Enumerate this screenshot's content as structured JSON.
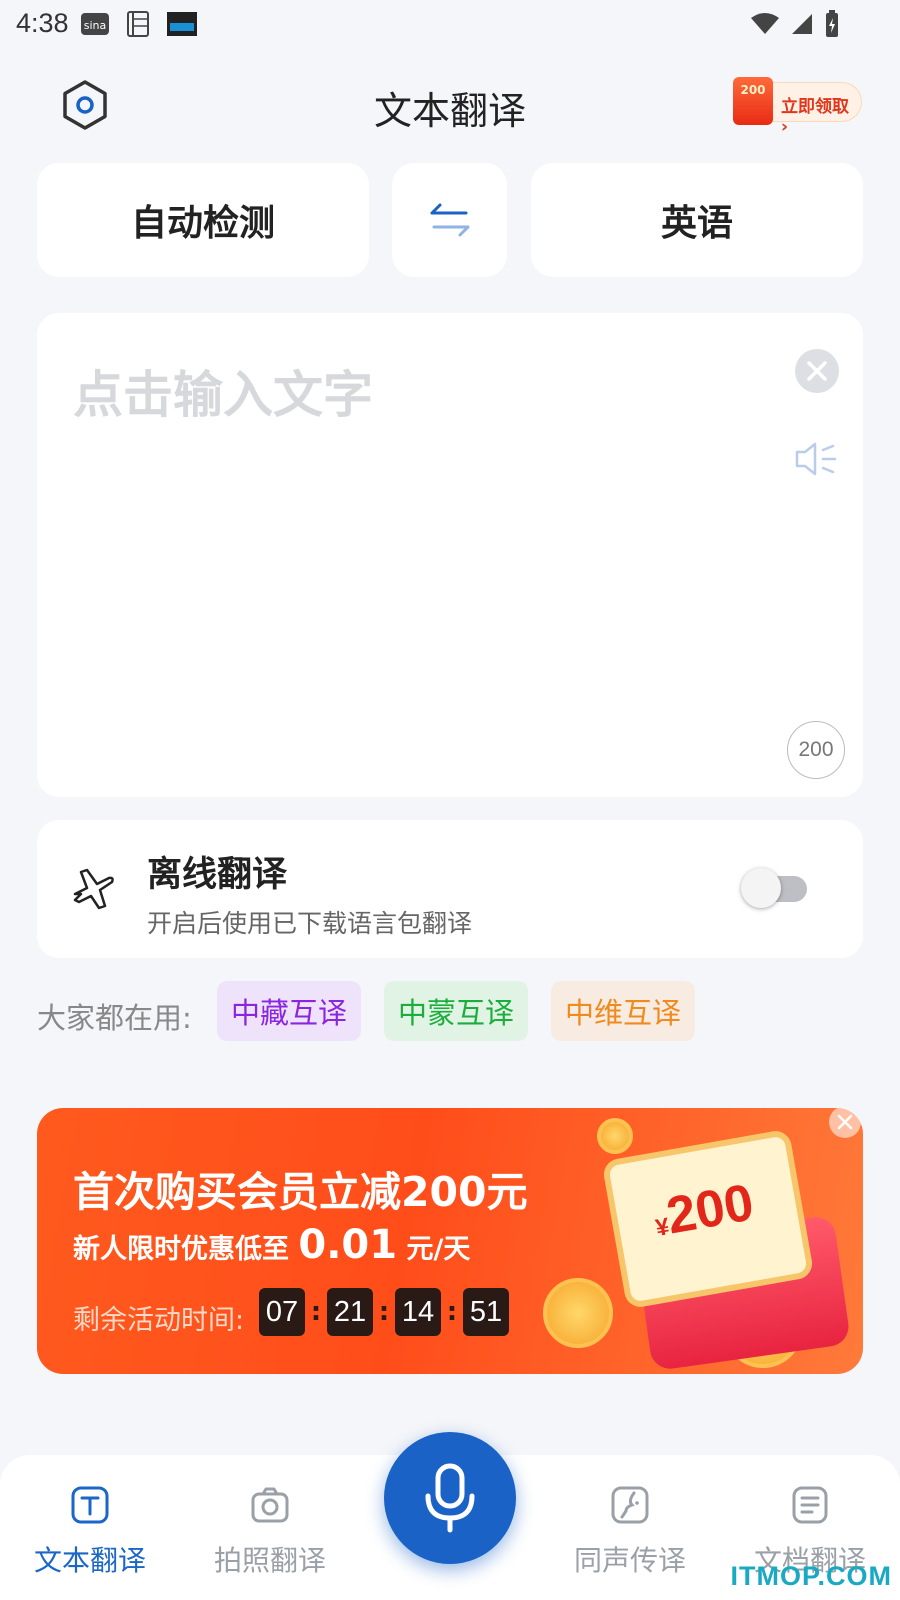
{
  "status_bar": {
    "time": "4:38"
  },
  "header": {
    "title": "文本翻译",
    "promo_amount": "200",
    "promo_label": "立即领取 ›"
  },
  "languages": {
    "source": "自动检测",
    "target": "英语"
  },
  "input": {
    "placeholder": "点击输入文字",
    "char_limit": "200"
  },
  "offline": {
    "title": "离线翻译",
    "subtitle": "开启后使用已下载语言包翻译",
    "enabled": false
  },
  "popular": {
    "label": "大家都在用:",
    "tags": [
      "中藏互译",
      "中蒙互译",
      "中维互译"
    ]
  },
  "banner": {
    "headline": "首次购买会员立减200元",
    "sub_prefix": "新人限时优惠低至",
    "sub_price": "0.01",
    "sub_suffix": "元/天",
    "countdown_label": "剩余活动时间:",
    "countdown": [
      "07",
      "21",
      "14",
      "51"
    ],
    "coupon_amount": "200",
    "coupon_currency": "¥"
  },
  "bottom_nav": {
    "items": [
      "文本翻译",
      "拍照翻译",
      "同声传译",
      "文档翻译"
    ],
    "active": "文本翻译"
  },
  "watermark": "ITMOP.COM",
  "colors": {
    "accent": "#1a62c6",
    "banner": "#ff5a1e",
    "tag_purple": "#8b25e0",
    "tag_green": "#1cae3c",
    "tag_orange": "#f08a1c"
  }
}
